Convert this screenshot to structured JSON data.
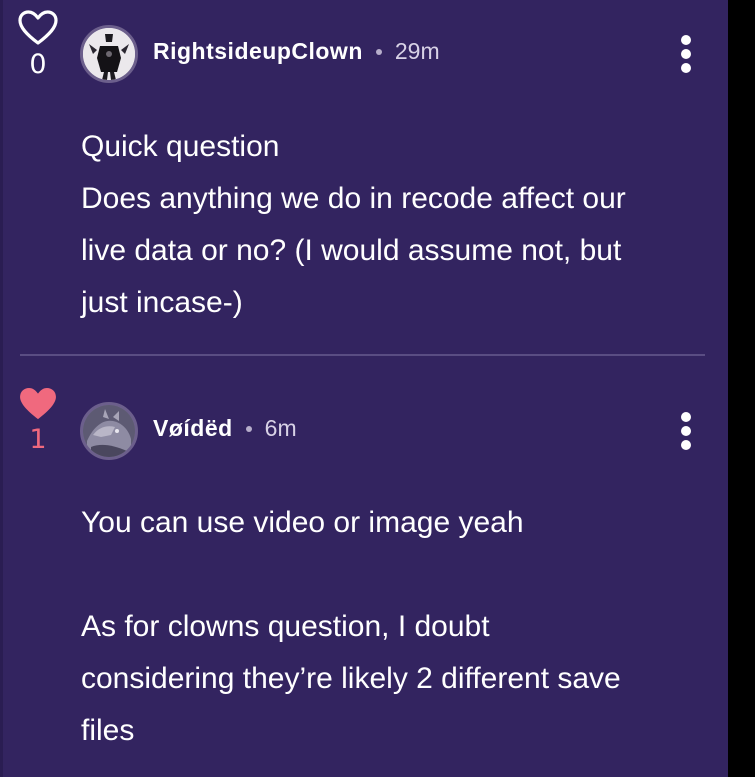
{
  "comments": [
    {
      "author": "RightsideupClown",
      "time": "29m",
      "likes": "0",
      "liked": false,
      "body": [
        "Quick question",
        "Does anything we do in recode affect our",
        "live data or no? (I would assume not, but",
        "just incase-)"
      ]
    },
    {
      "author": "Vøídëd",
      "time": "6m",
      "likes": "1",
      "liked": true,
      "body": [
        "You can use video or image yeah",
        "",
        "As for clowns question, I doubt",
        "considering they’re likely 2 different save",
        "files"
      ]
    }
  ],
  "icons": {
    "like_outline": "heart-outline-icon",
    "like_filled": "heart-filled-icon",
    "more": "more-vertical-icon"
  },
  "colors": {
    "background": "#332460",
    "liked": "#f0697e",
    "divider": "#5a4d83"
  }
}
